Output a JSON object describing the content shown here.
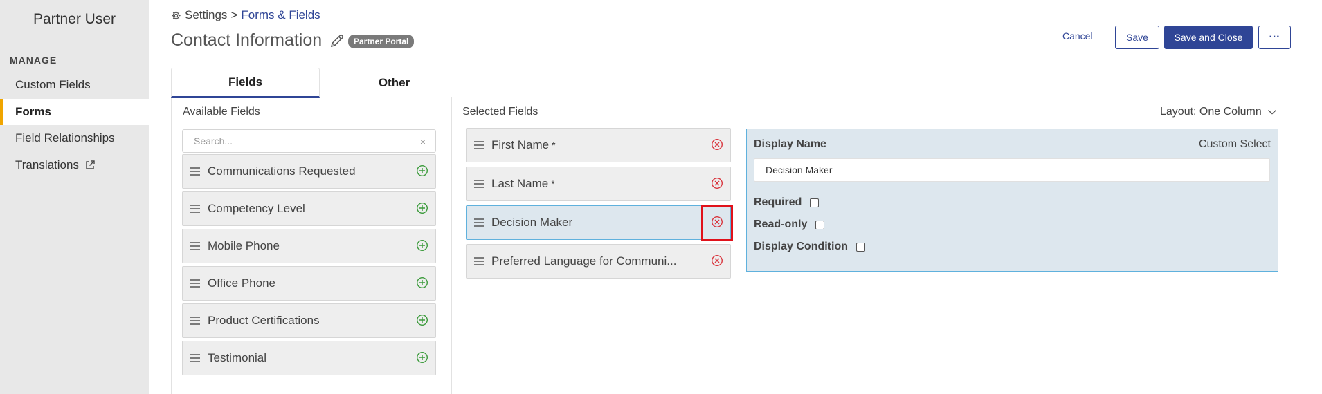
{
  "sidebar": {
    "user_title": "Partner User",
    "section_heading": "MANAGE",
    "items": [
      {
        "label": "Custom Fields"
      },
      {
        "label": "Forms"
      },
      {
        "label": "Field Relationships"
      },
      {
        "label": "Translations"
      }
    ]
  },
  "breadcrumb": {
    "root": "Settings",
    "separator": ">",
    "current": "Forms & Fields"
  },
  "header": {
    "title": "Contact Information",
    "badge": "Partner Portal",
    "cancel_label": "Cancel",
    "save_label": "Save",
    "save_close_label": "Save and Close",
    "more_label": "···"
  },
  "tabs": [
    {
      "label": "Fields"
    },
    {
      "label": "Other"
    }
  ],
  "available": {
    "label": "Available Fields",
    "search_placeholder": "Search...",
    "clear_glyph": "×",
    "fields": [
      {
        "label": "Communications Requested"
      },
      {
        "label": "Competency Level"
      },
      {
        "label": "Mobile Phone"
      },
      {
        "label": "Office Phone"
      },
      {
        "label": "Product Certifications"
      },
      {
        "label": "Testimonial"
      }
    ]
  },
  "selected": {
    "label": "Selected Fields",
    "layout": "Layout: One Column",
    "required_marker": "*",
    "fields": [
      {
        "label": "First Name"
      },
      {
        "label": "Last Name"
      },
      {
        "label": "Decision Maker"
      },
      {
        "label": "Preferred Language for Communi..."
      }
    ]
  },
  "detail": {
    "title": "Display Name",
    "type": "Custom Select",
    "display_name_value": "Decision Maker",
    "required_label": "Required",
    "readonly_label": "Read-only",
    "display_condition_label": "Display Condition"
  },
  "colors": {
    "primary": "#2f4596",
    "add_icon": "#3a9a3a",
    "remove_icon": "#d9363e",
    "highlight": "#e0121b",
    "active_accent": "#f0a500",
    "selected_bg": "#dde7ee",
    "selected_border": "#5fb1dd"
  }
}
